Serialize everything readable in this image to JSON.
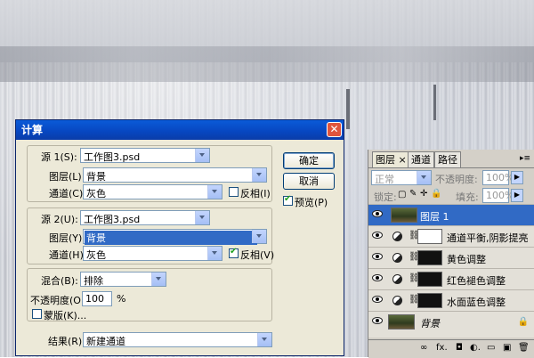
{
  "dialog": {
    "title": "计算",
    "close_glyph": "✕",
    "source1": {
      "label": "源 1(S):",
      "file": "工作图3.psd",
      "layer_label": "图层(L):",
      "layer": "背景",
      "channel_label": "通道(C):",
      "channel": "灰色",
      "invert_label": "反相(I)",
      "invert": false
    },
    "source2": {
      "label": "源 2(U):",
      "file": "工作图3.psd",
      "layer_label": "图层(Y):",
      "layer": "背景",
      "channel_label": "通道(H):",
      "channel": "灰色",
      "invert_label": "反相(V)",
      "invert": true
    },
    "blend": {
      "label": "混合(B):",
      "mode": "排除",
      "opacity_label": "不透明度(O):",
      "opacity": "100",
      "percent": "%",
      "mask_label": "蒙版(K)..."
    },
    "result": {
      "label": "结果(R):",
      "value": "新建通道"
    },
    "ok_label": "确定",
    "cancel_label": "取消",
    "preview_label": "预览(P)",
    "preview": true
  },
  "panel": {
    "tabs": [
      "图层 ×",
      "通道",
      "路径"
    ],
    "menu_glyph": "▸≡",
    "blend_mode": "正常",
    "opacity_label": "不透明度:",
    "opacity": "100%",
    "lock_label": "锁定:",
    "fill_label": "填充:",
    "fill": "100%",
    "layers": [
      {
        "name": "图层 1",
        "type": "pixel",
        "active": true
      },
      {
        "name": "通道平衡,阴影提亮",
        "type": "adjust",
        "mask": "white"
      },
      {
        "name": "黄色调整",
        "type": "adjust",
        "mask": "black"
      },
      {
        "name": "红色褪色调整",
        "type": "adjust",
        "mask": "black"
      },
      {
        "name": "水面蓝色调整",
        "type": "adjust",
        "mask": "black"
      },
      {
        "name": "背景",
        "type": "background",
        "lock": "🔒"
      }
    ],
    "footer_icons": [
      "∞",
      "fx.",
      "◘",
      "◐.",
      "▭",
      "▣",
      "🗑"
    ]
  }
}
